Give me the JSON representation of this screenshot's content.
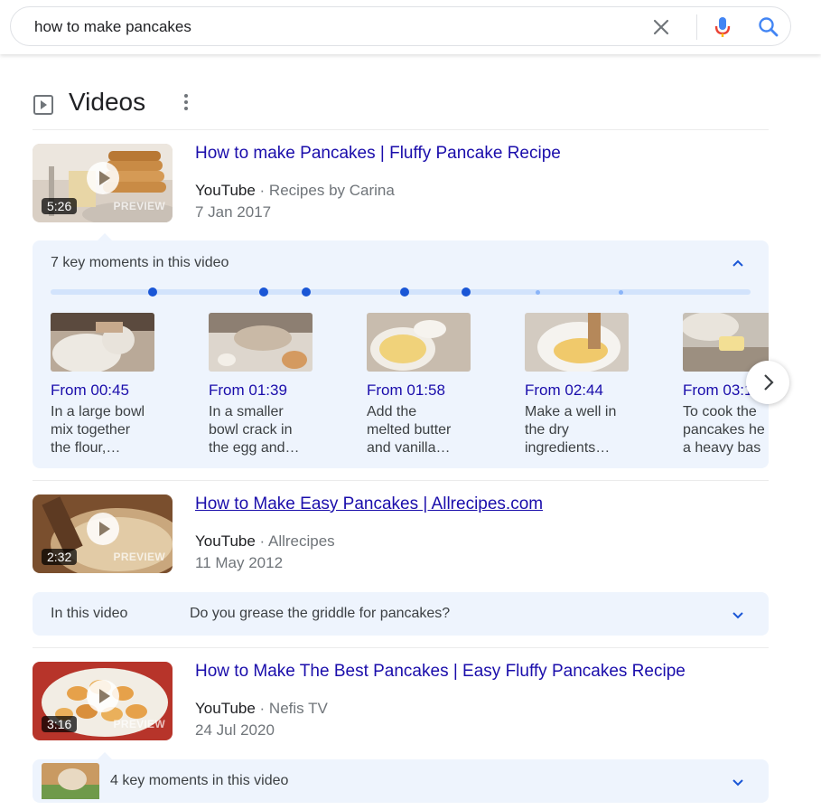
{
  "search": {
    "query": "how to make pancakes",
    "icons": {
      "clear": "close-icon",
      "voice": "microphone-icon",
      "submit": "search-icon"
    }
  },
  "videos_section": {
    "title": "Videos",
    "icon": "play-square-icon",
    "menu_icon": "more-vert-icon"
  },
  "videos": [
    {
      "title": "How to make Pancakes | Fluffy Pancake Recipe",
      "platform": "YouTube",
      "channel": "Recipes by Carina",
      "separator": " · ",
      "date": "7 Jan 2017",
      "duration": "5:26",
      "preview_label": "PREVIEW",
      "key_moments": {
        "label": "7 key moments in this video",
        "expanded": true,
        "moments": [
          {
            "time": "From 00:45",
            "desc": "In a large bowl\nmix together\nthe flour,…"
          },
          {
            "time": "From 01:39",
            "desc": "In a smaller\nbowl crack in\nthe egg and…"
          },
          {
            "time": "From 01:58",
            "desc": "Add the\nmelted butter\nand vanilla…"
          },
          {
            "time": "From 02:44",
            "desc": "Make a well in\nthe dry\ningredients…"
          },
          {
            "time": "From 03:1",
            "desc": "To cook the\npancakes he\na heavy bas"
          }
        ]
      }
    },
    {
      "title": "How to Make Easy Pancakes | Allrecipes.com",
      "platform": "YouTube",
      "channel": "Allrecipes",
      "separator": " · ",
      "date": "11 May 2012",
      "duration": "2:32",
      "preview_label": "PREVIEW",
      "in_video": {
        "label": "In this video",
        "question": "Do you grease the griddle for pancakes?"
      }
    },
    {
      "title": "How to Make The Best Pancakes | Easy Fluffy Pancakes Recipe",
      "platform": "YouTube",
      "channel": "Nefis TV",
      "separator": " · ",
      "date": "24 Jul 2020",
      "duration": "3:16",
      "preview_label": "PREVIEW",
      "key_moments": {
        "label": "4 key moments in this video",
        "expanded": false
      }
    }
  ],
  "colors": {
    "link": "#1a0dab",
    "panel_bg": "#eef4fd",
    "accent_blue": "#1a56d6",
    "meta_gray": "#70757a"
  }
}
